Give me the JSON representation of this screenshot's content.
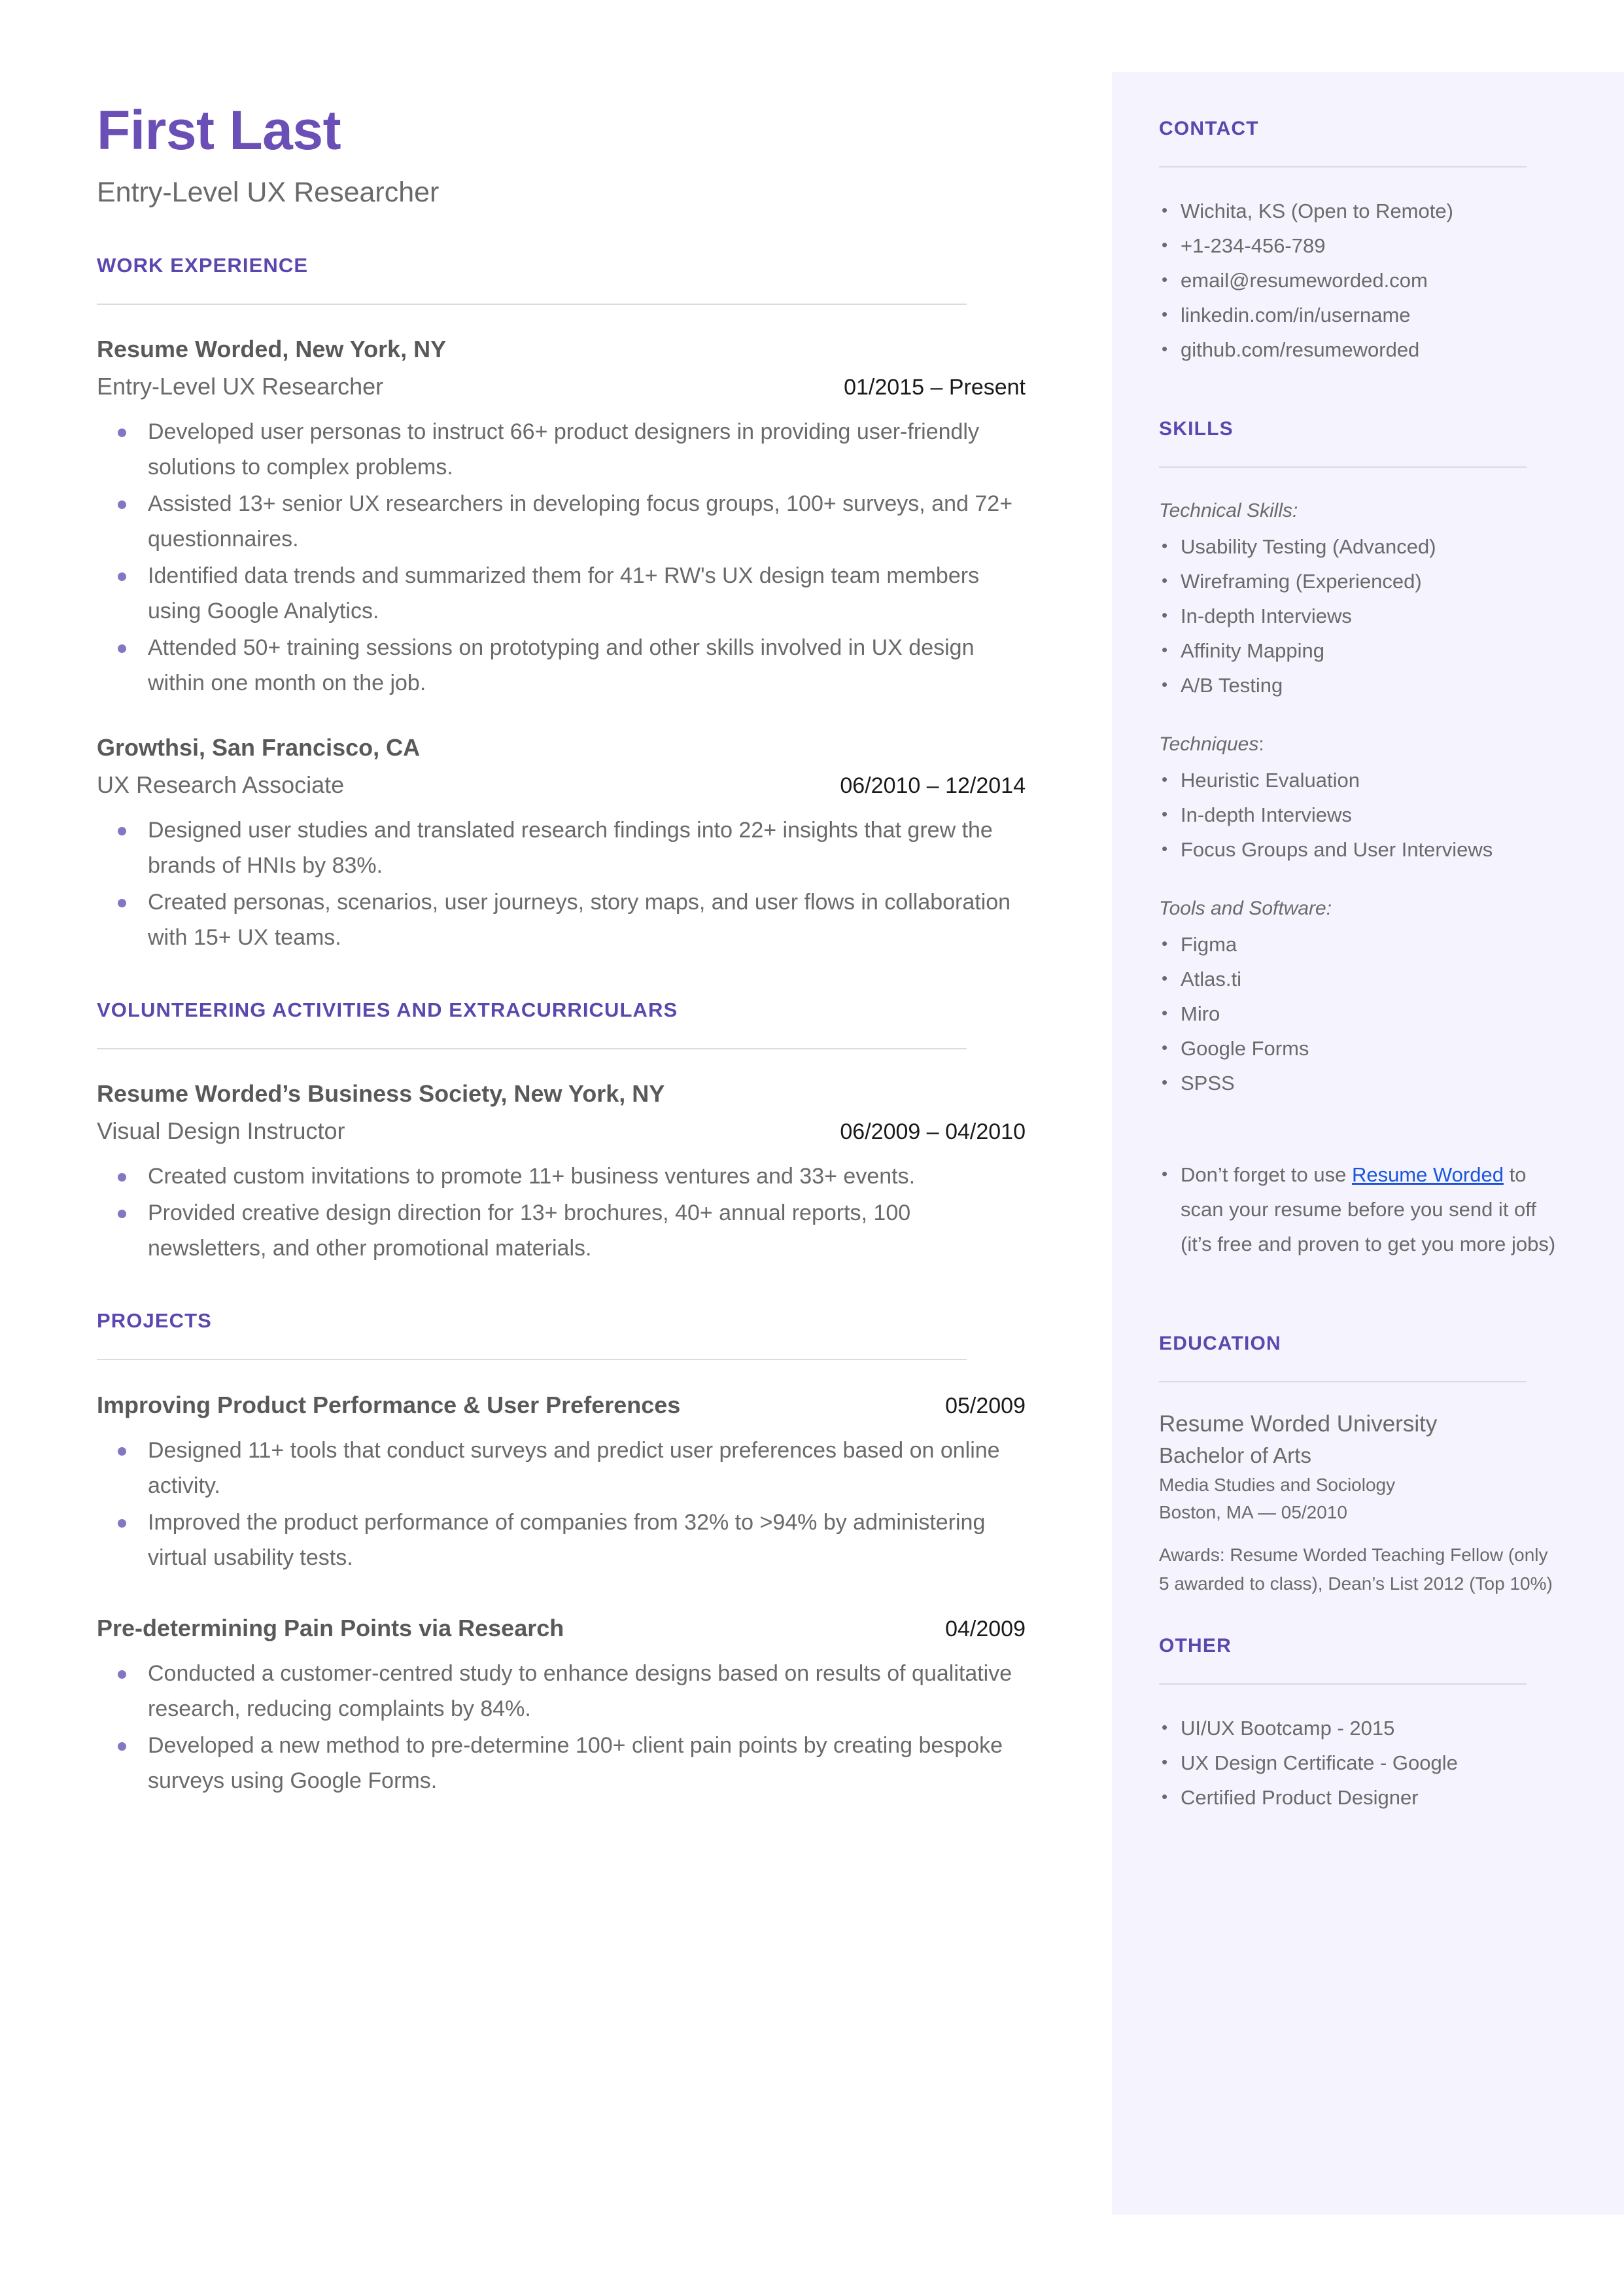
{
  "colors": {
    "accent_purple": "#5B47AE",
    "name_purple": "#6A4FB6",
    "sidebar_bg": "#F5F3FD",
    "bullet_purple": "#8277C2",
    "link_blue": "#1A56DB",
    "body_gray": "#6A6A6A"
  },
  "header": {
    "name": "First Last",
    "title": "Entry-Level UX Researcher"
  },
  "sections": {
    "work_experience": {
      "heading": "WORK EXPERIENCE",
      "entries": [
        {
          "organization": "Resume Worded, New York, NY",
          "role": "Entry-Level UX Researcher",
          "dates": "01/2015 – Present",
          "bullets": [
            "Developed user personas to instruct 66+ product designers in providing user-friendly solutions to complex problems.",
            "Assisted 13+ senior UX researchers in developing focus groups, 100+ surveys, and 72+ questionnaires.",
            "Identified data trends and summarized them for 41+ RW's UX design team members using Google Analytics.",
            "Attended 50+ training sessions on prototyping and other skills involved in UX design within one month on the job."
          ]
        },
        {
          "organization": "Growthsi, San Francisco, CA",
          "role": "UX Research Associate",
          "dates": "06/2010 – 12/2014",
          "bullets": [
            "Designed user studies and translated research findings into 22+ insights that grew the brands of HNIs by 83%.",
            "Created personas, scenarios, user journeys, story maps, and user flows in collaboration with 15+ UX teams."
          ]
        }
      ]
    },
    "volunteering": {
      "heading": "VOLUNTEERING ACTIVITIES AND EXTRACURRICULARS",
      "entries": [
        {
          "organization": "Resume Worded’s Business Society, New York, NY",
          "role": "Visual Design Instructor",
          "dates": "06/2009 – 04/2010",
          "bullets": [
            "Created custom invitations to promote 11+ business ventures and 33+ events.",
            "Provided creative design direction for 13+ brochures, 40+ annual reports, 100 newsletters, and other promotional materials."
          ]
        }
      ]
    },
    "projects": {
      "heading": "PROJECTS",
      "entries": [
        {
          "name": "Improving Product Performance & User Preferences",
          "date": "05/2009",
          "bullets": [
            "Designed 11+ tools that conduct surveys and predict user preferences based on online activity.",
            "Improved the product performance of companies from 32% to >94% by administering virtual usability tests."
          ]
        },
        {
          "name": "Pre-determining Pain Points via Research",
          "date": "04/2009",
          "bullets": [
            "Conducted a customer-centred study to enhance designs based on results of qualitative research, reducing complaints by 84%.",
            "Developed a new method to pre-determine 100+ client pain points by creating bespoke surveys using Google Forms."
          ]
        }
      ]
    }
  },
  "sidebar": {
    "contact": {
      "heading": "CONTACT",
      "items": [
        "Wichita, KS (Open to Remote)",
        "+1-234-456-789",
        "email@resumeworded.com",
        "linkedin.com/in/username",
        "github.com/resumeworded"
      ]
    },
    "skills": {
      "heading": "SKILLS",
      "groups": [
        {
          "label": "Technical Skills:",
          "label_italic_part": "Technical Skills:",
          "label_plain_part": "",
          "items": [
            "Usability Testing (Advanced)",
            "Wireframing (Experienced)",
            "In-depth Interviews",
            "Affinity Mapping",
            "A/B Testing"
          ]
        },
        {
          "label": "Techniques:",
          "label_italic_part": "Techniques",
          "label_plain_part": ":",
          "items": [
            "Heuristic Evaluation",
            "In-depth Interviews",
            "Focus Groups and User Interviews"
          ]
        },
        {
          "label": "Tools and Software:",
          "label_italic_part": "Tools and Software:",
          "label_plain_part": "",
          "items": [
            "Figma",
            "Atlas.ti",
            "Miro",
            "Google Forms",
            "SPSS"
          ]
        }
      ],
      "promo": {
        "prefix": "Don’t forget to use ",
        "link_text": "Resume Worded",
        "suffix": " to scan your resume before you send it off (it’s free and proven to get you more jobs)"
      }
    },
    "education": {
      "heading": "EDUCATION",
      "school": "Resume Worded University",
      "degree": "Bachelor of Arts",
      "field": "Media Studies and Sociology",
      "location_date": "Boston, MA — 05/2010",
      "awards": "Awards: Resume Worded Teaching Fellow (only 5 awarded to class), Dean’s List 2012 (Top 10%)"
    },
    "other": {
      "heading": "OTHER",
      "items": [
        "UI/UX Bootcamp - 2015",
        "UX Design Certificate - Google",
        "Certified Product Designer"
      ]
    }
  }
}
